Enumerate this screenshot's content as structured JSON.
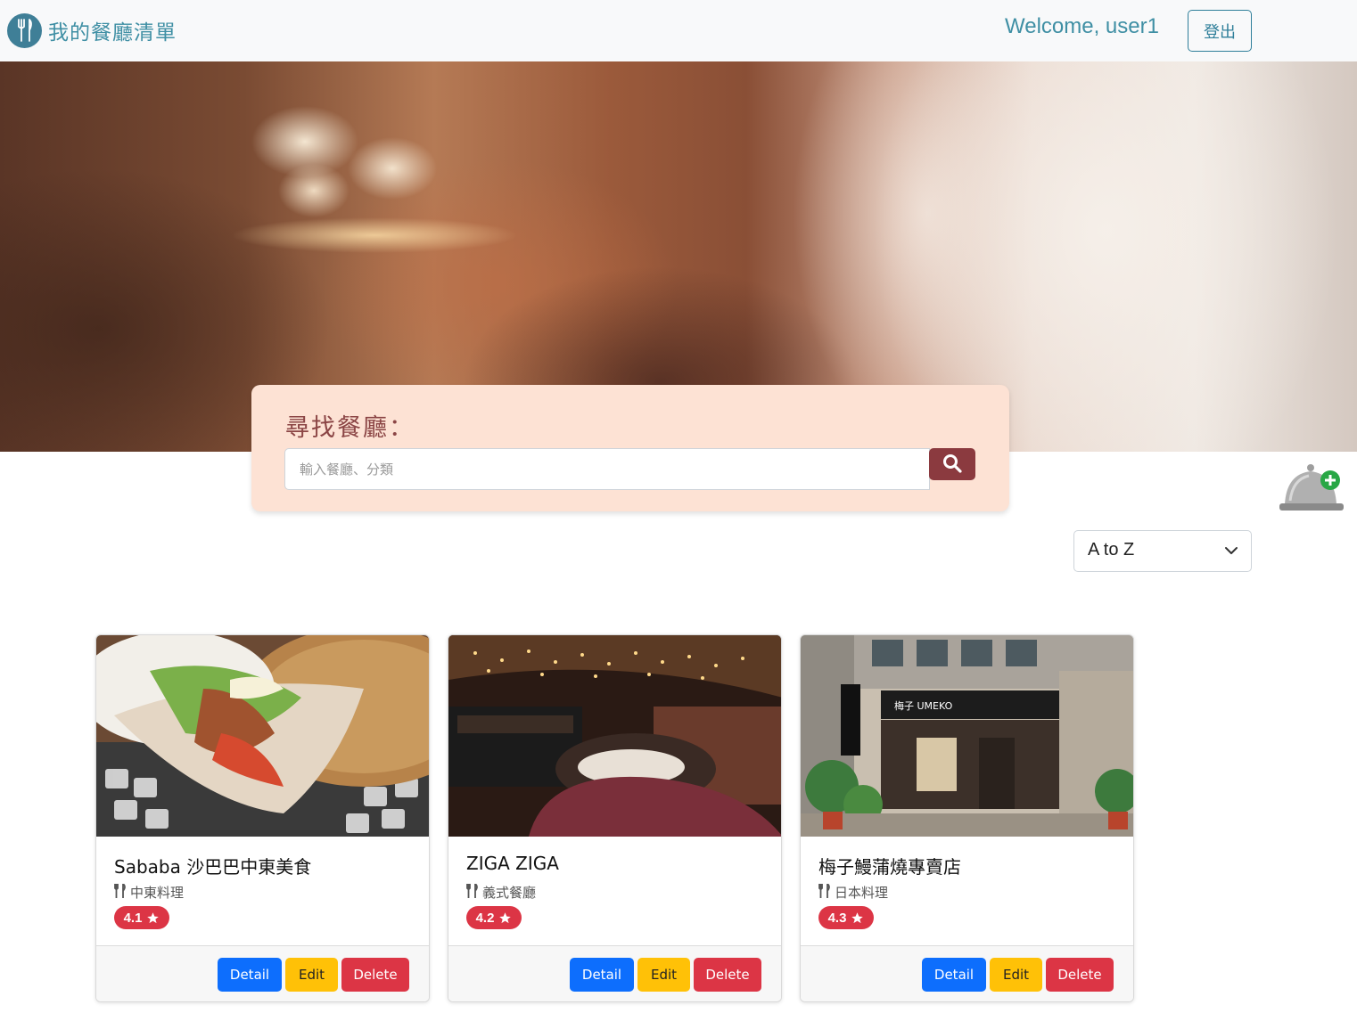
{
  "nav": {
    "brand_title": "我的餐廳清單",
    "welcome_text": "Welcome, user1",
    "logout_label": "登出"
  },
  "search": {
    "title": "尋找餐廳：",
    "placeholder": "輸入餐廳、分類"
  },
  "sort": {
    "selected": "A to Z"
  },
  "restaurants": [
    {
      "name": "Sababa 沙巴巴中東美食",
      "category": "中東料理",
      "rating": "4.1"
    },
    {
      "name": "ZIGA ZIGA",
      "category": "義式餐廳",
      "rating": "4.2"
    },
    {
      "name": "梅子鰻蒲燒專賣店",
      "category": "日本料理",
      "rating": "4.3"
    }
  ],
  "card_buttons": {
    "detail": "Detail",
    "edit": "Edit",
    "delete": "Delete"
  },
  "icons": {
    "brand": "utensils-icon",
    "search": "search-icon",
    "add": "add-restaurant-cloche-icon",
    "category": "utensils-icon",
    "rating": "star-icon",
    "sort": "chevron-down-icon"
  },
  "colors": {
    "brand_text": "#3f8fa4",
    "search_panel": "#fde2d4",
    "search_button": "#8b3a3f",
    "detail": "#0d6efd",
    "edit": "#ffc107",
    "delete": "#dc3545",
    "rating_badge": "#dc3545"
  }
}
